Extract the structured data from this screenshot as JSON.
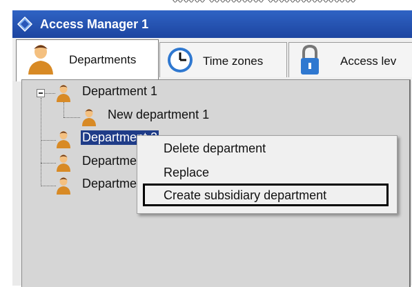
{
  "window": {
    "title": "Access Manager 1"
  },
  "tabs": [
    {
      "label": "Departments",
      "icon": "person-icon",
      "active": true
    },
    {
      "label": "Time zones",
      "icon": "clock-icon",
      "active": false
    },
    {
      "label": "Access lev",
      "icon": "padlock-icon",
      "active": false
    }
  ],
  "tree": {
    "root": "Department 1",
    "child": "New department 1",
    "selected": "Department 2",
    "item3": "Departme",
    "item4": "Departme"
  },
  "context_menu": {
    "items": [
      "Delete department",
      "Replace",
      "Create subsidiary department"
    ],
    "highlighted": "Create subsidiary department"
  },
  "colors": {
    "titlebar": "#2f63c4",
    "selection": "#1f3c88",
    "person": "#d88a25"
  }
}
